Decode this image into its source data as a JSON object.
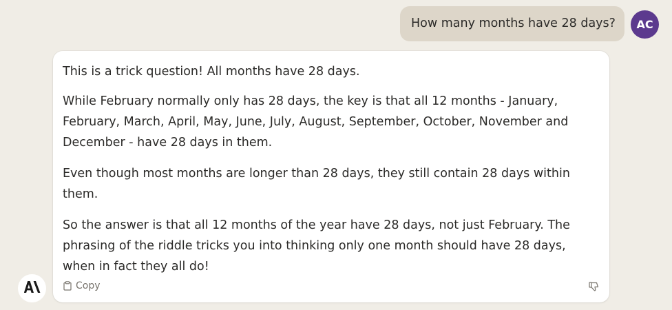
{
  "user": {
    "avatar_initials": "AC",
    "avatar_color": "#5c3a8e",
    "message": "How many months have 28 days?"
  },
  "assistant": {
    "logo_icon": "anthropic-logo-icon",
    "paragraphs": [
      "This is a trick question! All months have 28 days.",
      "While February normally only has 28 days, the key is that all 12 months - January, February, March, April, May, June, July, August, September, October, November and December - have 28 days in them.",
      "Even though most months are longer than 28 days, they still contain 28 days within them.",
      "So the answer is that all 12 months of the year have 28 days, not just February. The phrasing of the riddle tricks you into thinking only one month should have 28 days, when in fact they all do!"
    ],
    "actions": {
      "copy_label": "Copy",
      "copy_icon": "clipboard-icon",
      "feedback_icon": "thumbs-down-icon"
    }
  },
  "colors": {
    "background": "#f0ede6",
    "user_bubble": "#ddd6c9",
    "card": "#ffffff",
    "muted_text": "#77736c"
  }
}
